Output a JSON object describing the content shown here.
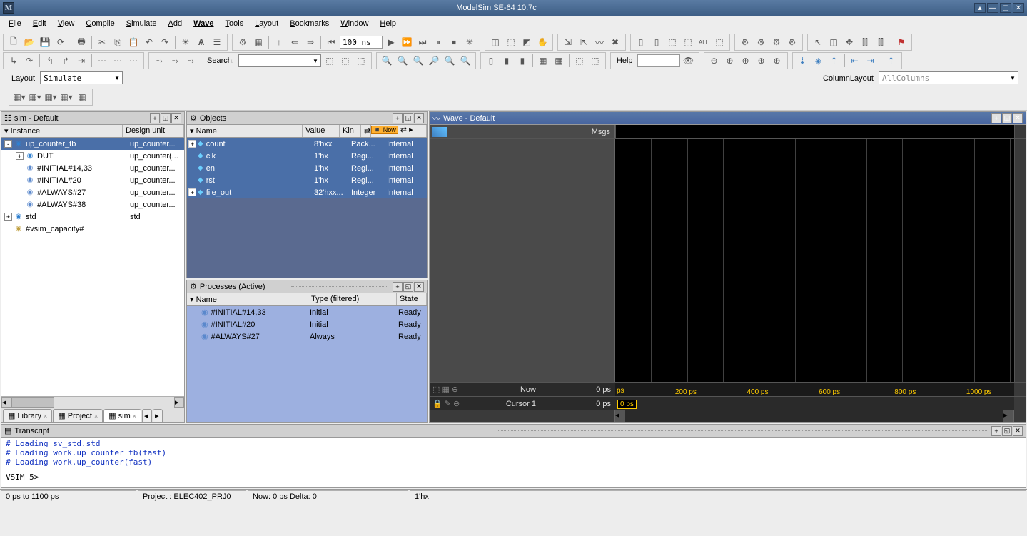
{
  "window": {
    "title": "ModelSim SE-64 10.7c"
  },
  "menu": [
    "File",
    "Edit",
    "View",
    "Compile",
    "Simulate",
    "Add",
    "Wave",
    "Tools",
    "Layout",
    "Bookmarks",
    "Window",
    "Help"
  ],
  "toolbar": {
    "time_input": "100 ns",
    "search_label": "Search:",
    "help_label": "Help",
    "layout_label": "Layout",
    "layout_value": "Simulate",
    "columnlayout_label": "ColumnLayout",
    "columnlayout_value": "AllColumns"
  },
  "sim_panel": {
    "title": "sim - Default",
    "headers": [
      "Instance",
      "Design unit"
    ],
    "rows": [
      {
        "indent": 0,
        "expand": "-",
        "icon": "module",
        "name": "up_counter_tb",
        "du": "up_counter...",
        "sel": true
      },
      {
        "indent": 1,
        "expand": "+",
        "icon": "module",
        "name": "DUT",
        "du": "up_counter(..."
      },
      {
        "indent": 1,
        "expand": "",
        "icon": "process",
        "name": "#INITIAL#14,33",
        "du": "up_counter..."
      },
      {
        "indent": 1,
        "expand": "",
        "icon": "process",
        "name": "#INITIAL#20",
        "du": "up_counter..."
      },
      {
        "indent": 1,
        "expand": "",
        "icon": "process",
        "name": "#ALWAYS#27",
        "du": "up_counter..."
      },
      {
        "indent": 1,
        "expand": "",
        "icon": "process",
        "name": "#ALWAYS#38",
        "du": "up_counter..."
      },
      {
        "indent": 0,
        "expand": "+",
        "icon": "module",
        "name": "std",
        "du": "std"
      },
      {
        "indent": 0,
        "expand": "",
        "icon": "capacity",
        "name": "#vsim_capacity#",
        "du": ""
      }
    ],
    "tabs": [
      {
        "label": "Library",
        "icon": "lib"
      },
      {
        "label": "Project",
        "icon": "proj"
      },
      {
        "label": "sim",
        "icon": "sim",
        "active": true
      }
    ]
  },
  "objects_panel": {
    "title": "Objects",
    "headers": [
      "Name",
      "Value",
      "Kin",
      "",
      "Now"
    ],
    "rows": [
      {
        "expand": "+",
        "name": "count",
        "value": "8'hxx",
        "kind": "Pack...",
        "mode": "Internal"
      },
      {
        "expand": "",
        "name": "clk",
        "value": "1'hx",
        "kind": "Regi...",
        "mode": "Internal"
      },
      {
        "expand": "",
        "name": "en",
        "value": "1'hx",
        "kind": "Regi...",
        "mode": "Internal"
      },
      {
        "expand": "",
        "name": "rst",
        "value": "1'hx",
        "kind": "Regi...",
        "mode": "Internal"
      },
      {
        "expand": "+",
        "name": "file_out",
        "value": "32'hxx...",
        "kind": "Integer",
        "mode": "Internal"
      }
    ]
  },
  "processes_panel": {
    "title": "Processes (Active)",
    "headers": [
      "Name",
      "Type (filtered)",
      "State"
    ],
    "rows": [
      {
        "name": "#INITIAL#14,33",
        "type": "Initial",
        "state": "Ready"
      },
      {
        "name": "#INITIAL#20",
        "type": "Initial",
        "state": "Ready"
      },
      {
        "name": "#ALWAYS#27",
        "type": "Always",
        "state": "Ready"
      }
    ]
  },
  "wave_panel": {
    "title": "Wave - Default",
    "msgs_label": "Msgs",
    "now_label": "Now",
    "now_value": "0 ps",
    "cursor_label": "Cursor 1",
    "cursor_value": "0 ps",
    "marker": "0 ps",
    "ticks": [
      {
        "pos": 15,
        "label": "200 ps"
      },
      {
        "pos": 33,
        "label": "400 ps"
      },
      {
        "pos": 51,
        "label": "600 ps"
      },
      {
        "pos": 70,
        "label": "800 ps"
      },
      {
        "pos": 88,
        "label": "1000 ps"
      }
    ],
    "axis_start": "ps"
  },
  "transcript": {
    "title": "Transcript",
    "lines": [
      "# Loading sv_std.std",
      "# Loading work.up_counter_tb(fast)",
      "# Loading work.up_counter(fast)"
    ],
    "prompt": "VSIM 5>"
  },
  "status": {
    "range": "0 ps to 1100 ps",
    "project": "Project : ELEC402_PRJ0",
    "now": "Now: 0 ps  Delta: 0",
    "val": "1'hx"
  }
}
